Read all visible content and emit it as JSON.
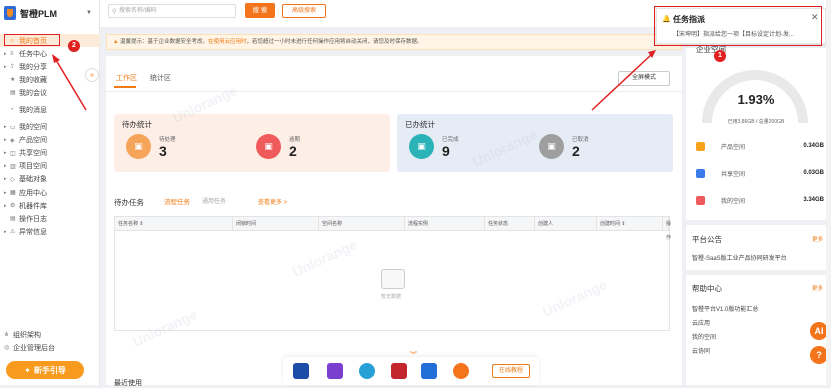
{
  "app": {
    "name": "智橙PLM"
  },
  "sidebar": {
    "items": [
      {
        "label": "我的首页",
        "arrow": "",
        "icon": "home-icon"
      },
      {
        "label": "任务中心",
        "arrow": "▸",
        "icon": "list-icon"
      },
      {
        "label": "我的分享",
        "arrow": "▸",
        "icon": "share-icon"
      },
      {
        "label": "我的收藏",
        "arrow": "",
        "icon": "star-icon"
      },
      {
        "label": "我的会议",
        "arrow": "",
        "icon": "meeting-icon"
      },
      {
        "label": "我的消息",
        "arrow": "",
        "icon": "bell-icon"
      },
      {
        "label": "我的空间",
        "arrow": "▸",
        "icon": "folder-icon"
      },
      {
        "label": "产品空间",
        "arrow": "▸",
        "icon": "product-icon"
      },
      {
        "label": "共享空间",
        "arrow": "▸",
        "icon": "shared-icon"
      },
      {
        "label": "项目空间",
        "arrow": "▸",
        "icon": "project-icon"
      },
      {
        "label": "基础对象",
        "arrow": "▸",
        "icon": "object-icon"
      },
      {
        "label": "应用中心",
        "arrow": "▸",
        "icon": "app-icon"
      },
      {
        "label": "机器件库",
        "arrow": "▸",
        "icon": "parts-icon"
      },
      {
        "label": "操作日志",
        "arrow": "",
        "icon": "log-icon"
      },
      {
        "label": "异常信息",
        "arrow": "▸",
        "icon": "warning-icon"
      }
    ],
    "bottom": [
      {
        "label": "组织架构",
        "icon": "org-icon"
      },
      {
        "label": "企业管理后台",
        "icon": "admin-icon"
      }
    ],
    "guide_label": "新手引导"
  },
  "topbar": {
    "search_placeholder": "搜索名称/编码",
    "search_button": "搜 索",
    "advanced_button": "高级搜索"
  },
  "alert": {
    "prefix": "温馨提示：",
    "text1": "基于企业数据安全考虑，",
    "highlight": "在使用云应用时",
    "text2": "，若您超过一小时未进行任何操作应用将自动关闭，请您及时保存数据。"
  },
  "main": {
    "tabs": [
      "工作区",
      "统计区"
    ],
    "fullscreen": "全屏模式",
    "todo": {
      "title": "待办统计",
      "items": [
        {
          "label": "待处理",
          "value": "3"
        },
        {
          "label": "逾期",
          "value": "2"
        }
      ]
    },
    "done": {
      "title": "已办统计",
      "items": [
        {
          "label": "已完成",
          "value": "9"
        },
        {
          "label": "已取消",
          "value": "2"
        }
      ]
    },
    "tasks": {
      "title": "待办任务",
      "tab_flow": "流程任务",
      "tab_general": "通用任务",
      "more": "查看更多 >",
      "columns": [
        "任务名称 ⇕",
        "闭锁时间",
        "空间名称",
        "流程实例",
        "任务状态",
        "创建人",
        "创建时间 ⇕",
        "操作"
      ],
      "empty": "暂无数据"
    },
    "recent": "最近使用"
  },
  "right_panel": {
    "space_title": "企业空间",
    "usage_percent": "1.93%",
    "usage_detail": "已用3.86GB / 总量200GB",
    "spaces": [
      {
        "name": "产品空间",
        "size": "0.34GB",
        "color": "#f6a31e"
      },
      {
        "name": "共享空间",
        "size": "0.03GB",
        "color": "#3b7be8"
      },
      {
        "name": "我的空间",
        "size": "3.34GB",
        "color": "#ef5b5b"
      }
    ],
    "announce_title": "平台公告",
    "announce_more": "更多",
    "announce_item": "智橙-SaaS版工业产品协同研发平台",
    "help_title": "帮助中心",
    "help_more": "更多",
    "help_items": [
      "智橙平台V1.0版功能汇总",
      "云应用",
      "我的空间",
      "云协同"
    ]
  },
  "notification": {
    "title": "任务指派",
    "body": "【宋坤明】指派给您一项【目标设定计划-发..."
  },
  "annotations": {
    "badge1": "1",
    "badge2": "2"
  },
  "dock": {
    "online_label": "在线教程"
  },
  "float": {
    "ai": "AI",
    "help": "?"
  },
  "watermark": "Unlorange"
}
